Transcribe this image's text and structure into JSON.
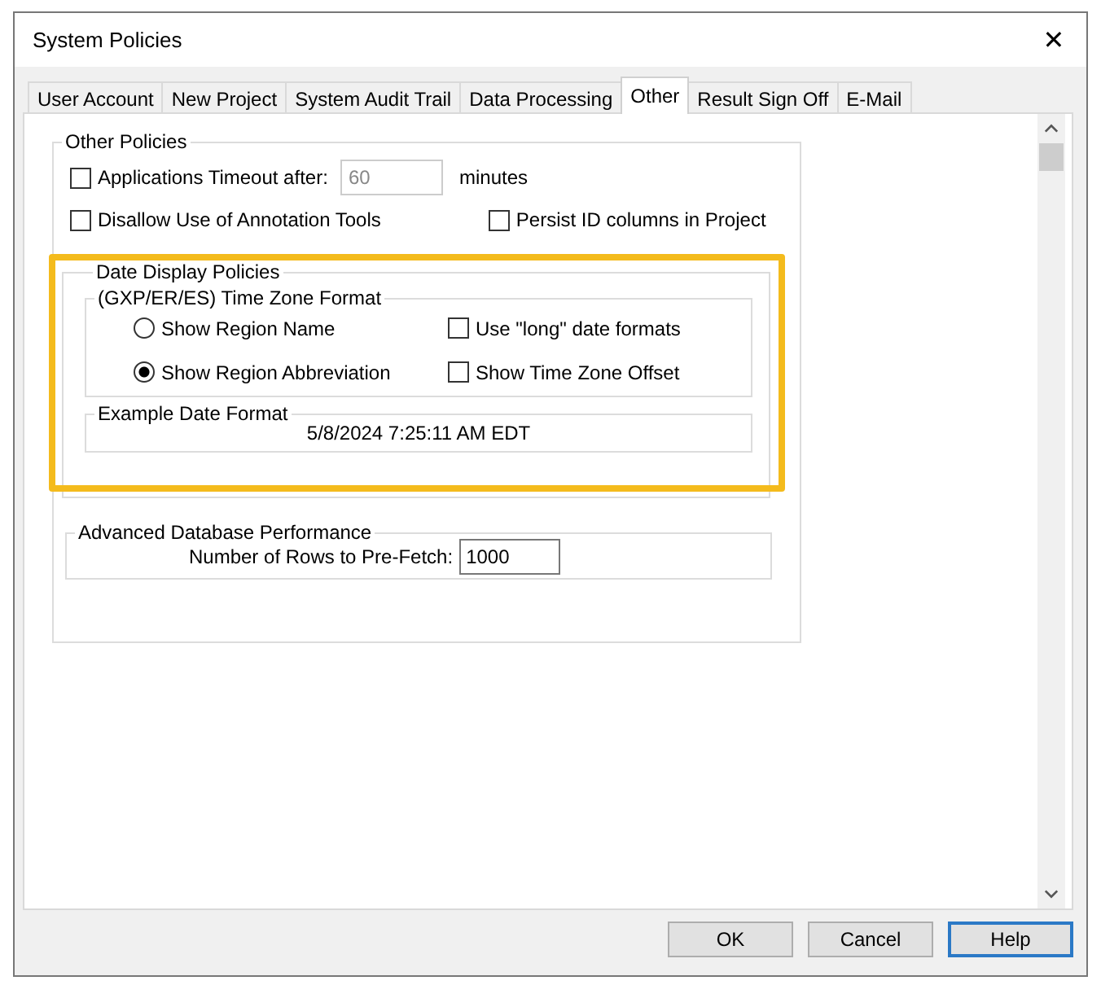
{
  "window": {
    "title": "System Policies",
    "close": "✕"
  },
  "tabs": [
    {
      "label": "User Account",
      "selected": false
    },
    {
      "label": "New Project",
      "selected": false
    },
    {
      "label": "System Audit Trail",
      "selected": false
    },
    {
      "label": "Data Processing",
      "selected": false
    },
    {
      "label": "Other",
      "selected": true
    },
    {
      "label": "Result Sign Off",
      "selected": false
    },
    {
      "label": "E-Mail",
      "selected": false
    }
  ],
  "other_policies": {
    "title": "Other Policies",
    "timeout": {
      "label": "Applications Timeout after:",
      "checked": false,
      "value": "60",
      "disabled": true,
      "unit": "minutes"
    },
    "checkboxes": [
      {
        "label": "Disallow Use of Annotation Tools",
        "checked": false
      },
      {
        "label": "Persist ID columns in Project",
        "checked": false
      }
    ]
  },
  "date_display": {
    "title": "Date Display Policies",
    "highlighted": true,
    "time_zone_format": {
      "title": "(GXP/ER/ES) Time Zone Format",
      "options": [
        {
          "label": "Show Region Name",
          "selected": false
        },
        {
          "label": "Show Region Abbreviation",
          "selected": true
        }
      ],
      "checkboxes": [
        {
          "label": "Use \"long\" date formats",
          "checked": false
        },
        {
          "label": "Show Time Zone Offset",
          "checked": false
        }
      ]
    },
    "example": {
      "title": "Example Date Format",
      "value": "5/8/2024 7:25:11 AM EDT"
    }
  },
  "advanced": {
    "title": "Advanced Database Performance",
    "label": "Number of Rows to Pre-Fetch:",
    "value": "1000"
  },
  "buttons": [
    {
      "label": "OK",
      "focused": false
    },
    {
      "label": "Cancel",
      "focused": false
    },
    {
      "label": "Help",
      "focused": true
    }
  ]
}
